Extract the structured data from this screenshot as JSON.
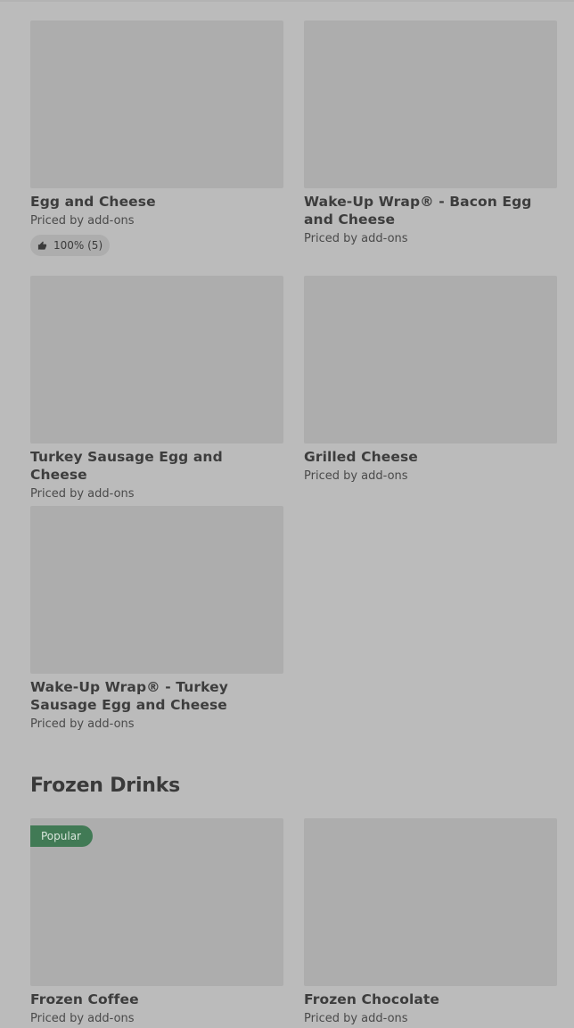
{
  "items_group1": [
    {
      "title": "Egg and Cheese",
      "price": "Priced by add-ons",
      "rating": "100% (5)"
    },
    {
      "title": "Wake-Up Wrap® - Bacon Egg and Cheese",
      "price": "Priced by add-ons"
    },
    {
      "title": "Turkey Sausage Egg and Cheese",
      "price": "Priced by add-ons"
    },
    {
      "title": "Grilled Cheese",
      "price": "Priced by add-ons"
    },
    {
      "title": "Wake-Up Wrap® - Turkey Sausage Egg and Cheese",
      "price": "Priced by add-ons"
    }
  ],
  "frozen_section": {
    "title": "Frozen Drinks",
    "items": [
      {
        "title": "Frozen Coffee",
        "price": "Priced by add-ons",
        "badge": "Popular"
      },
      {
        "title": "Frozen Chocolate",
        "price": "Priced by add-ons"
      }
    ]
  },
  "icons": {
    "rating": "thumbs-up-icon"
  },
  "colors": {
    "background": "#bbbbbb",
    "image_placeholder": "#adadad",
    "popular_badge": "#417a55"
  }
}
